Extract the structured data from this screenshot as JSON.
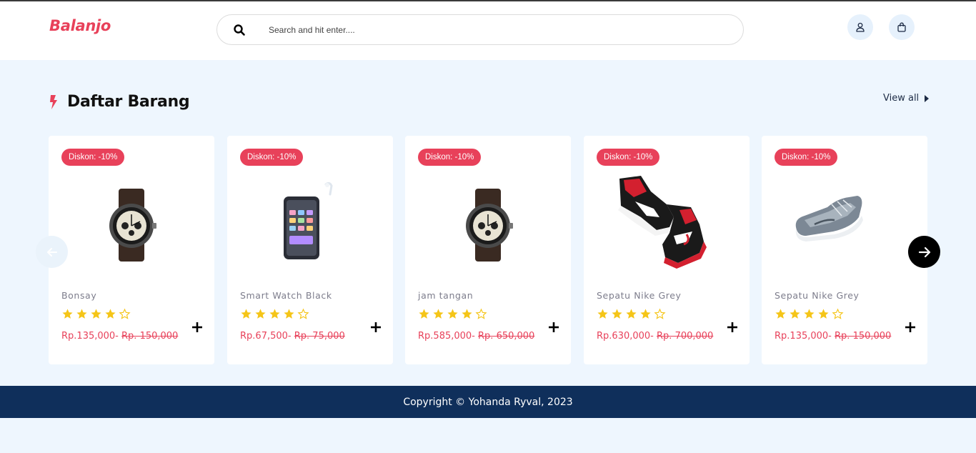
{
  "header": {
    "logo": "Balanjo",
    "search_placeholder": "Search and hit enter....",
    "search_icon": "search-icon",
    "user_icon": "user-icon",
    "bag_icon": "shopping-bag-icon"
  },
  "section": {
    "title": "Daftar Barang",
    "icon": "bolt-icon",
    "view_all": "View all"
  },
  "colors": {
    "brand": "#e8415a",
    "footer": "#0f2f5b",
    "background": "#eef6fe",
    "star": "#f5c518"
  },
  "products": [
    {
      "badge": "Diskon: -10%",
      "name": "Bonsay",
      "rating": 4,
      "price": "Rp.135,000-",
      "old_price": "Rp. 150,000",
      "image": "watch"
    },
    {
      "badge": "Diskon: -10%",
      "name": "Smart Watch Black",
      "rating": 4,
      "price": "Rp.67,500-",
      "old_price": "Rp. 75,000",
      "image": "phone"
    },
    {
      "badge": "Diskon: -10%",
      "name": "jam tangan",
      "rating": 4,
      "price": "Rp.585,000-",
      "old_price": "Rp. 650,000",
      "image": "watch"
    },
    {
      "badge": "Diskon: -10%",
      "name": "Sepatu Nike Grey",
      "rating": 4,
      "price": "Rp.630,000-",
      "old_price": "Rp. 700,000",
      "image": "sneakers-red"
    },
    {
      "badge": "Diskon: -10%",
      "name": "Sepatu Nike Grey",
      "rating": 4,
      "price": "Rp.135,000-",
      "old_price": "Rp. 150,000",
      "image": "sneaker-grey"
    }
  ],
  "carousel": {
    "prev_icon": "arrow-left-icon",
    "next_icon": "arrow-right-icon"
  },
  "footer": {
    "copyright": "Copyright © Yohanda Ryval, 2023"
  }
}
